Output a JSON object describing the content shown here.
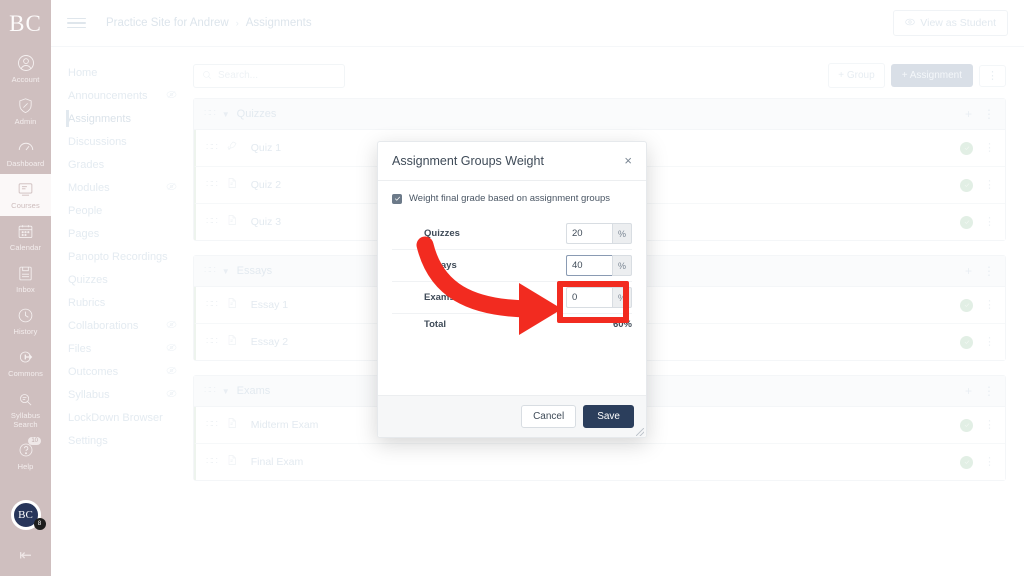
{
  "global_nav": {
    "logo": "BC",
    "items": [
      {
        "label": "Account",
        "icon": "account-icon",
        "active": false
      },
      {
        "label": "Admin",
        "icon": "admin-shield-icon",
        "active": false
      },
      {
        "label": "Dashboard",
        "icon": "dashboard-icon",
        "active": false
      },
      {
        "label": "Courses",
        "icon": "courses-icon",
        "active": true
      },
      {
        "label": "Calendar",
        "icon": "calendar-icon",
        "active": false
      },
      {
        "label": "Inbox",
        "icon": "inbox-icon",
        "active": false
      },
      {
        "label": "History",
        "icon": "history-clock-icon",
        "active": false
      },
      {
        "label": "Commons",
        "icon": "commons-icon",
        "active": false
      },
      {
        "label": "Syllabus Search",
        "icon": "syllabus-search-icon",
        "active": false
      },
      {
        "label": "Help",
        "icon": "help-icon",
        "active": false,
        "badge": "10"
      }
    ],
    "avatar_initials": "BC",
    "avatar_badge": "8",
    "collapse_label": "⇤"
  },
  "topbar": {
    "menu_icon": "hamburger-icon",
    "breadcrumb": {
      "course": "Practice Site for Andrew",
      "separator": "›",
      "page": "Assignments"
    },
    "view_as_student": "View as Student",
    "view_as_student_icon": "eye-student-icon"
  },
  "course_nav": {
    "items": [
      {
        "label": "Home",
        "hidden": false,
        "active": false
      },
      {
        "label": "Announcements",
        "hidden": true,
        "active": false
      },
      {
        "label": "Assignments",
        "hidden": false,
        "active": true
      },
      {
        "label": "Discussions",
        "hidden": false,
        "active": false
      },
      {
        "label": "Grades",
        "hidden": false,
        "active": false
      },
      {
        "label": "Modules",
        "hidden": true,
        "active": false
      },
      {
        "label": "People",
        "hidden": false,
        "active": false
      },
      {
        "label": "Pages",
        "hidden": false,
        "active": false
      },
      {
        "label": "Panopto Recordings",
        "hidden": false,
        "active": false
      },
      {
        "label": "Quizzes",
        "hidden": false,
        "active": false
      },
      {
        "label": "Rubrics",
        "hidden": false,
        "active": false
      },
      {
        "label": "Collaborations",
        "hidden": true,
        "active": false
      },
      {
        "label": "Files",
        "hidden": true,
        "active": false
      },
      {
        "label": "Outcomes",
        "hidden": true,
        "active": false
      },
      {
        "label": "Syllabus",
        "hidden": true,
        "active": false
      },
      {
        "label": "LockDown Browser",
        "hidden": false,
        "active": false
      },
      {
        "label": "Settings",
        "hidden": false,
        "active": false
      }
    ]
  },
  "content": {
    "search_placeholder": "Search...",
    "search_value": "",
    "add_group_label": "+ Group",
    "add_assignment_label": "+ Assignment",
    "more_options_label": "⋮",
    "groups": [
      {
        "name": "Quizzes",
        "assignments": [
          {
            "name": "Quiz 1",
            "icon": "quiz-rocket-icon",
            "published": true
          },
          {
            "name": "Quiz 2",
            "icon": "assignment-doc-icon",
            "published": true
          },
          {
            "name": "Quiz 3",
            "icon": "assignment-doc-icon",
            "published": true
          }
        ]
      },
      {
        "name": "Essays",
        "assignments": [
          {
            "name": "Essay 1",
            "icon": "assignment-doc-icon",
            "published": true
          },
          {
            "name": "Essay 2",
            "icon": "assignment-doc-icon",
            "published": true
          }
        ]
      },
      {
        "name": "Exams",
        "assignments": [
          {
            "name": "Midterm Exam",
            "icon": "assignment-doc-icon",
            "published": true
          },
          {
            "name": "Final Exam",
            "icon": "assignment-doc-icon",
            "published": true
          }
        ]
      }
    ]
  },
  "modal": {
    "title": "Assignment Groups Weight",
    "close_label": "×",
    "checkbox_label": "Weight final grade based on assignment groups",
    "checkbox_checked": true,
    "percent_suffix": "%",
    "rows": [
      {
        "label": "Quizzes",
        "value": "20",
        "focused": false
      },
      {
        "label": "Essays",
        "value": "40",
        "focused": true
      },
      {
        "label": "Exams",
        "value": "0",
        "focused": false
      }
    ],
    "total_label": "Total",
    "total_value": "60%",
    "cancel_label": "Cancel",
    "save_label": "Save"
  },
  "annotation": {
    "arrow_color": "#f22b20",
    "highlight_color": "#f22b20",
    "target": "exams-weight-input"
  }
}
